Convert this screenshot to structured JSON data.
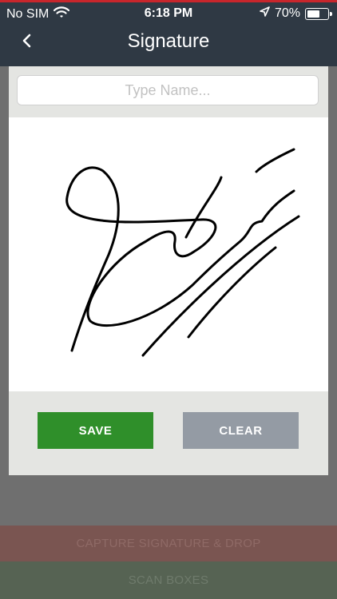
{
  "status_bar": {
    "carrier": "No SIM",
    "time": "6:18 PM",
    "battery_percent": "70%",
    "battery_level": 0.7,
    "icons": [
      "wifi-icon",
      "location-arrow-icon",
      "battery-icon"
    ]
  },
  "header": {
    "title": "Signature",
    "back_icon": "chevron-left-icon"
  },
  "signature_form": {
    "name_placeholder": "Type Name...",
    "name_value": ""
  },
  "buttons": {
    "save_label": "SAVE",
    "clear_label": "CLEAR"
  },
  "background_actions": {
    "capture_label": "CAPTURE SIGNATURE & DROP",
    "scan_label": "SCAN BOXES"
  },
  "colors": {
    "header_bg": "#2f3944",
    "accent_red": "#c8262c",
    "save_green": "#2f8f2a",
    "clear_gray": "#949ba4"
  }
}
